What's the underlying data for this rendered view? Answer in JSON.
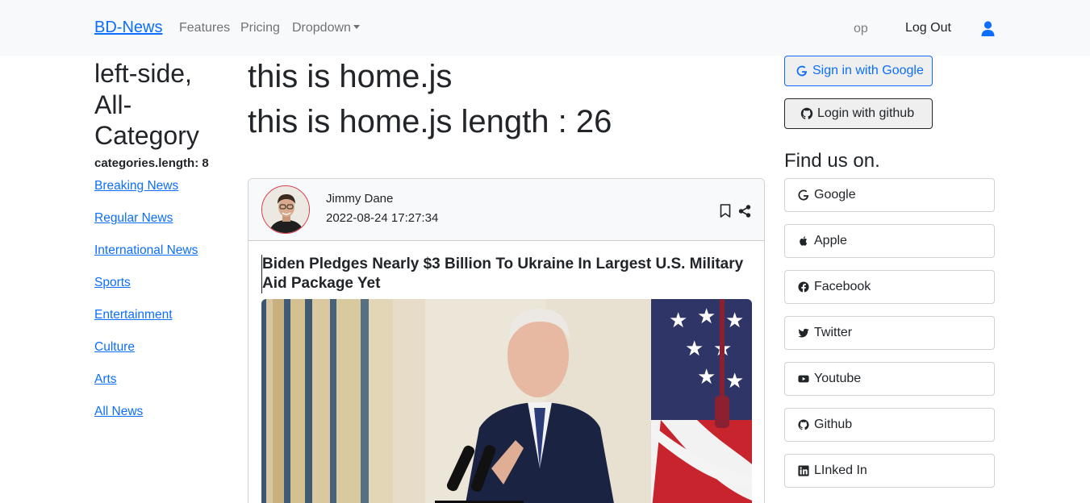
{
  "navbar": {
    "brand": "BD-News",
    "links": [
      "Features",
      "Pricing",
      "Dropdown"
    ],
    "user_text": "op",
    "logout": "Log Out"
  },
  "left": {
    "title": "left-side, All-Category",
    "categories_length": "categories.length: 8",
    "categories": [
      "Breaking News",
      "Regular News",
      "International News",
      "Sports",
      "Entertainment",
      "Culture",
      "Arts",
      "All News"
    ]
  },
  "main": {
    "title1": "this is home.js",
    "title2": "this is home.js length : 26",
    "card": {
      "author_name": "Jimmy Dane",
      "published_date": "2022-08-24 17:27:34",
      "news_title": "Biden Pledges Nearly $3 Billion To Ukraine In Largest U.S. Military Aid Package Yet"
    }
  },
  "right": {
    "google_login": "Sign in with Google",
    "github_login": "Login with github",
    "find_us_title": "Find us on.",
    "social": [
      "Google",
      "Apple",
      "Facebook",
      "Twitter",
      "Youtube",
      "Github",
      "LInked In"
    ]
  },
  "colors": {
    "primary": "#0d6efd",
    "navbar_bg": "#f8f9fa",
    "avatar_border": "#dc3545"
  }
}
